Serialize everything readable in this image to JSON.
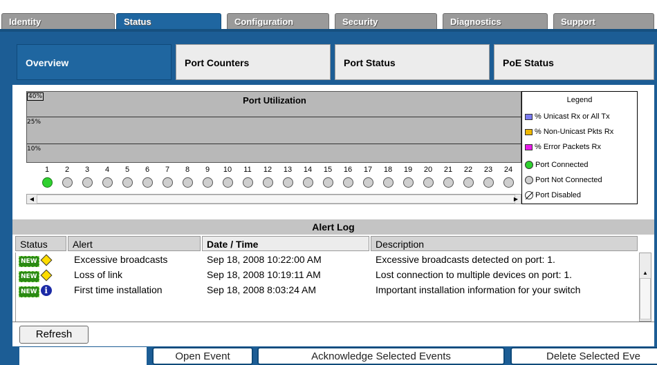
{
  "tabs": [
    {
      "label": "Identity",
      "active": false
    },
    {
      "label": "Status",
      "active": true
    },
    {
      "label": "Configuration",
      "active": false
    },
    {
      "label": "Security",
      "active": false
    },
    {
      "label": "Diagnostics",
      "active": false
    },
    {
      "label": "Support",
      "active": false
    }
  ],
  "subtabs": [
    {
      "label": "Overview",
      "active": true
    },
    {
      "label": "Port Counters",
      "active": false
    },
    {
      "label": "Port Status",
      "active": false
    },
    {
      "label": "PoE Status",
      "active": false
    }
  ],
  "utilization": {
    "title": "Port Utilization",
    "scale_labels": [
      "40%",
      "25%",
      "10%"
    ]
  },
  "ports": {
    "numbers": [
      "1",
      "2",
      "3",
      "4",
      "5",
      "6",
      "7",
      "8",
      "9",
      "10",
      "11",
      "12",
      "13",
      "14",
      "15",
      "16",
      "17",
      "18",
      "19",
      "20",
      "21",
      "22",
      "23",
      "24"
    ],
    "connected": [
      true,
      false,
      false,
      false,
      false,
      false,
      false,
      false,
      false,
      false,
      false,
      false,
      false,
      false,
      false,
      false,
      false,
      false,
      false,
      false,
      false,
      false,
      false,
      false
    ]
  },
  "legend": {
    "title": "Legend",
    "unicast": "% Unicast Rx or All Tx",
    "nonunicast": "% Non-Unicast Pkts Rx",
    "error": "% Error Packets Rx",
    "connected": "Port Connected",
    "not_connected": "Port Not Connected",
    "disabled": "Port Disabled",
    "colors": {
      "unicast": "#7a7af2",
      "nonunicast": "#f0b800",
      "error": "#e81ae8",
      "connected": "#2fd12f",
      "not_connected": "#cfcfcf"
    }
  },
  "alert_log": {
    "title": "Alert Log",
    "columns": [
      "Status",
      "Alert",
      "Date / Time",
      "Description"
    ],
    "new_badge": "NEW",
    "rows": [
      {
        "severity": "warning",
        "alert": "Excessive broadcasts",
        "datetime": "Sep 18, 2008 10:22:00 AM",
        "description": "Excessive broadcasts detected on port: 1."
      },
      {
        "severity": "warning",
        "alert": "Loss of link",
        "datetime": "Sep 18, 2008 10:19:11 AM",
        "description": "Lost connection to multiple devices on port: 1."
      },
      {
        "severity": "info",
        "alert": "First time installation",
        "datetime": "Sep 18, 2008 8:03:24 AM",
        "description": "Important installation information for your switch"
      }
    ]
  },
  "buttons": {
    "refresh": "Refresh",
    "open_event": "Open Event",
    "acknowledge": "Acknowledge Selected Events",
    "delete": "Delete Selected Eve"
  }
}
